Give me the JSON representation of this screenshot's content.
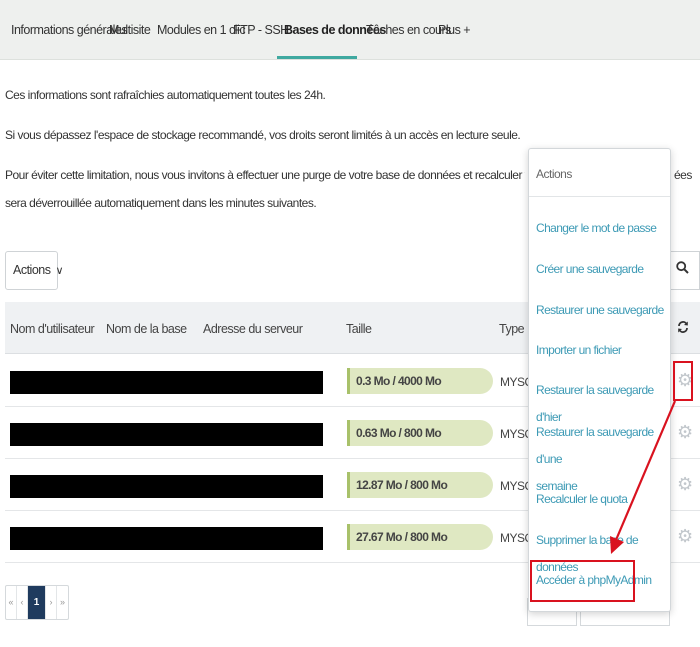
{
  "tabs": [
    {
      "label": "Informations générales"
    },
    {
      "label": "Multisite"
    },
    {
      "label": "Modules en 1 clic"
    },
    {
      "label": "FTP - SSH"
    },
    {
      "label": "Bases de données",
      "active": true
    },
    {
      "label": "Tâches en cours"
    },
    {
      "label": "Plus +"
    }
  ],
  "info": {
    "line1": "Ces informations sont rafraîchies automatiquement toutes les 24h.",
    "line2": "Si vous dépassez l'espace de stockage recommandé, vos droits seront limités à un accès en lecture seule.",
    "line3a": "Pour éviter cette limitation, nous vous invitons à effectuer une purge de votre base de données et recalculer vos quotas afin de repasser en dessous de la",
    "line3b": "ées",
    "line4": "sera déverrouillée automatiquement dans les minutes suivantes."
  },
  "toolbar": {
    "actions_label": "Actions",
    "chevron": "∨",
    "search_icon_glyph": "🔍"
  },
  "table": {
    "headers": {
      "user": "Nom d'utilisateur",
      "db": "Nom de la base",
      "server": "Adresse du serveur",
      "size": "Taille",
      "type": "Type"
    },
    "rows": [
      {
        "quota": "0.3 Mo / 4000 Mo",
        "type": "MYSQL v"
      },
      {
        "quota": "0.63 Mo / 800 Mo",
        "type": "MYSQL v"
      },
      {
        "quota": "12.87 Mo / 800 Mo",
        "type": "MYSQL v"
      },
      {
        "quota": "27.67 Mo / 800 Mo",
        "type": "MYSQL v"
      }
    ]
  },
  "pagination": {
    "first": "«",
    "prev": "‹",
    "current": "1",
    "next": "›",
    "last": "»"
  },
  "menu": {
    "title": "Actions",
    "items": {
      "change_password": "Changer le mot de passe",
      "create_backup": "Créer une sauvegarde",
      "restore_backup": "Restaurer une sauvegarde",
      "import_file": "Importer un fichier",
      "restore_yesterday": "Restaurer la sauvegarde d'hier",
      "restore_week_1": "Restaurer la sauvegarde d'une",
      "restore_week_2": "semaine",
      "recalc_quota": "Recalculer le quota",
      "delete_db": "Supprimer la base de données",
      "phpmyadmin": "Accéder à phpMyAdmin"
    }
  },
  "colors": {
    "accent": "#3fa9a0",
    "link": "#3d9ab5",
    "highlight": "#d9121f",
    "quota_fill": "#dfe8c2",
    "pager_active": "#1f3b5e"
  }
}
